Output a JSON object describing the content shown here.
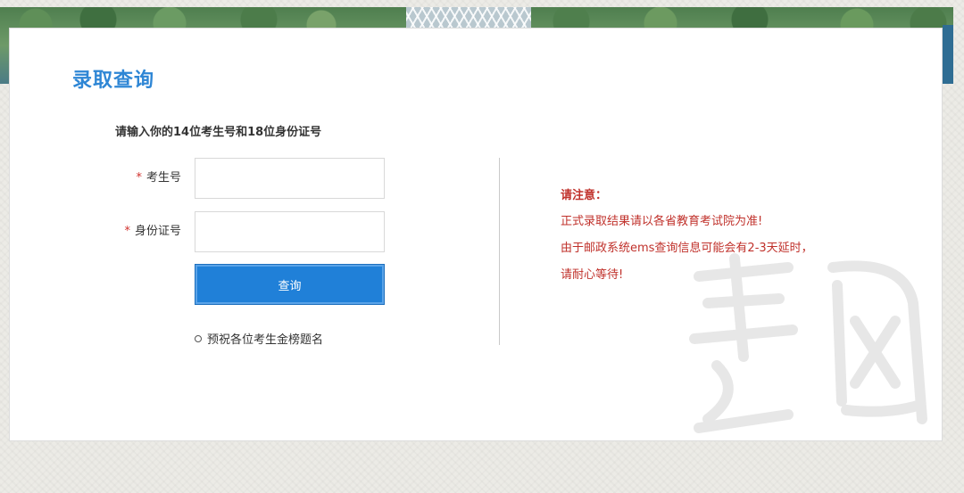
{
  "page": {
    "title": "录取查询",
    "instruction": "请输入你的14位考生号和18位身份证号"
  },
  "form": {
    "required_mark": "*",
    "exam_number_label": "考生号",
    "exam_number_value": "",
    "id_number_label": "身份证号",
    "id_number_value": "",
    "submit_label": "查询",
    "wish_text": "预祝各位考生金榜题名"
  },
  "notice": {
    "heading": "请注意：",
    "lines": [
      "正式录取结果请以各省教育考试院为准!",
      "由于邮政系统ems查询信息可能会有2-3天延时，",
      "请耐心等待!"
    ]
  },
  "colors": {
    "accent": "#2e86d5",
    "button": "#2080d8",
    "notice": "#c0312b"
  }
}
